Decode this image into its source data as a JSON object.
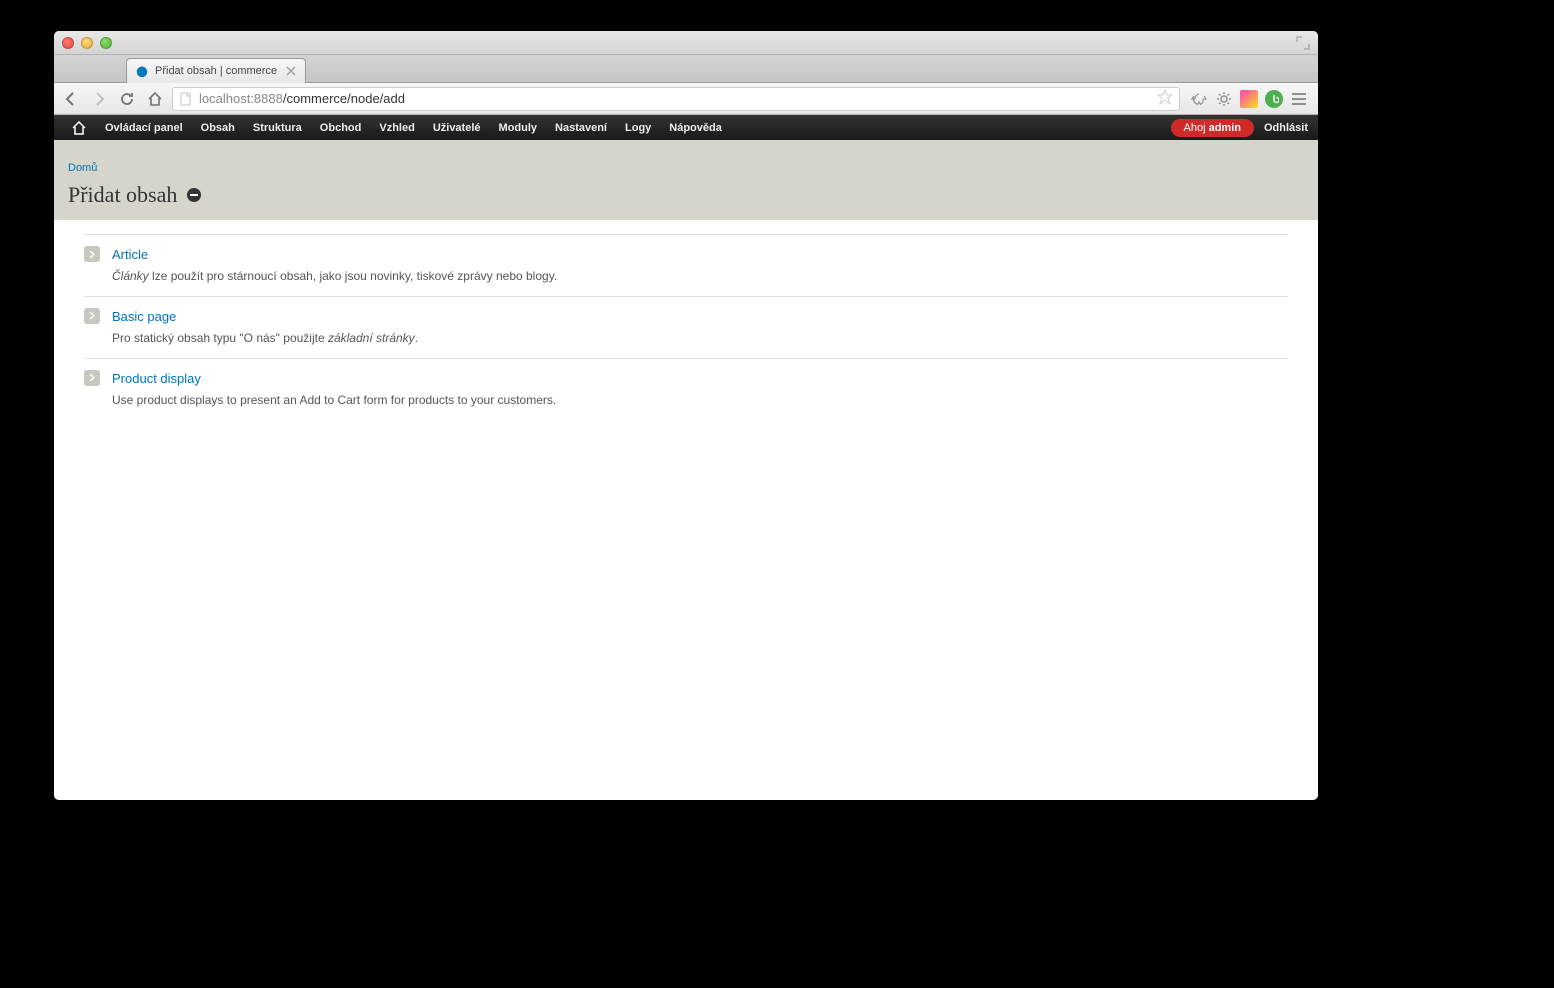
{
  "window": {
    "tab_title": "Přidat obsah | commerce"
  },
  "browser": {
    "url_host": "localhost",
    "url_port": ":8888",
    "url_path": "/commerce/node/add"
  },
  "toolbar": {
    "items": [
      "Ovládací panel",
      "Obsah",
      "Struktura",
      "Obchod",
      "Vzhled",
      "Uživatelé",
      "Moduly",
      "Nastavení",
      "Logy",
      "Nápověda"
    ],
    "hello_prefix": "Ahoj ",
    "hello_user": "admin",
    "logout": "Odhlásit"
  },
  "breadcrumb": {
    "home": "Domů"
  },
  "page": {
    "title": "Přidat obsah"
  },
  "node_types": [
    {
      "title": "Article",
      "desc_emph": "Články",
      "desc_rest": " lze použít pro stárnoucí obsah, jako jsou novinky, tiskové zprávy nebo blogy."
    },
    {
      "title": "Basic page",
      "desc_prefix": "Pro statický obsah typu \"O nás\" použijte ",
      "desc_emph": "základní stránky",
      "desc_suffix": "."
    },
    {
      "title": "Product display",
      "desc_plain": "Use product displays to present an Add to Cart form for products to your customers."
    }
  ]
}
